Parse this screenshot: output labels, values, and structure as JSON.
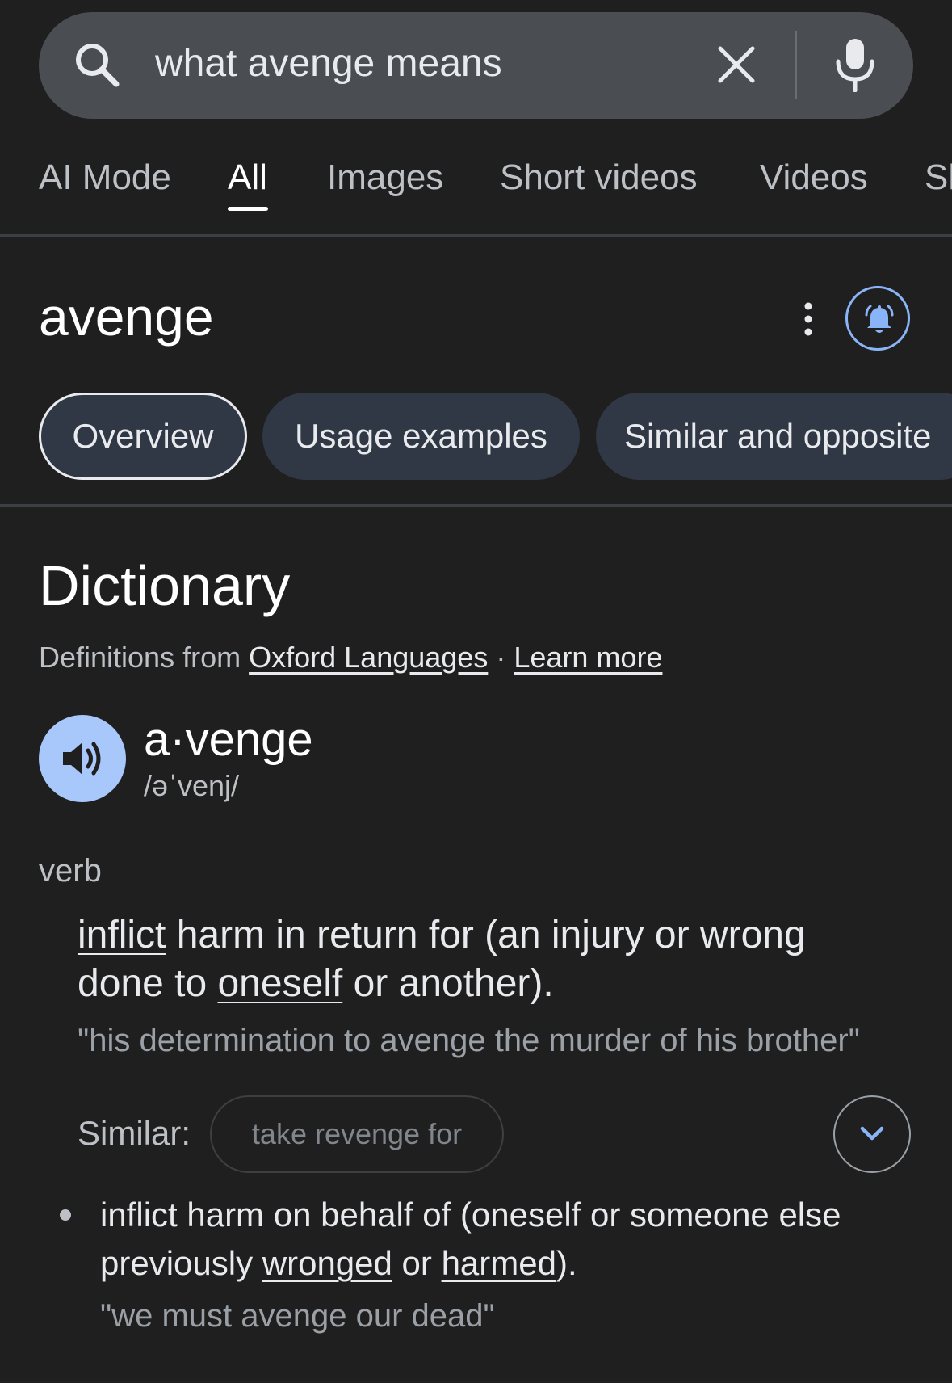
{
  "search": {
    "query": "what avenge means",
    "icons": {
      "search": "search-icon",
      "clear": "close-icon",
      "mic": "mic-icon"
    }
  },
  "tabs": [
    {
      "label": "AI Mode",
      "active": false
    },
    {
      "label": "All",
      "active": true
    },
    {
      "label": "Images",
      "active": false
    },
    {
      "label": "Short videos",
      "active": false
    },
    {
      "label": "Videos",
      "active": false
    },
    {
      "label": "Sh",
      "active": false
    }
  ],
  "header": {
    "word": "avenge",
    "icons": {
      "more": "more-vert-icon",
      "alert": "bell-icon"
    }
  },
  "chips": [
    {
      "label": "Overview",
      "active": true
    },
    {
      "label": "Usage examples",
      "active": false
    },
    {
      "label": "Similar and opposite",
      "active": false
    }
  ],
  "dictionary": {
    "title": "Dictionary",
    "source_prefix": "Definitions from",
    "source_link": "Oxford Languages",
    "separator": "·",
    "learn_more": "Learn more",
    "headword": "a·venge",
    "phonetic": "/əˈvenj/",
    "part_of_speech": "verb",
    "definitions": [
      {
        "parts": [
          {
            "text": "inflict",
            "link": true
          },
          {
            "text": " harm in return for (an injury or wrong done to ",
            "link": false
          },
          {
            "text": "oneself",
            "link": true
          },
          {
            "text": " or another).",
            "link": false
          }
        ],
        "example": "\"his determination to avenge the murder of his brother\"",
        "similar_label": "Similar:",
        "similar_chip": "take revenge for"
      },
      {
        "parts": [
          {
            "text": "inflict harm on behalf of (oneself or someone else previously ",
            "link": false
          },
          {
            "text": "wronged",
            "link": true
          },
          {
            "text": " or ",
            "link": false
          },
          {
            "text": "harmed",
            "link": true
          },
          {
            "text": ").",
            "link": false
          }
        ],
        "example": "\"we must avenge our dead\""
      }
    ]
  },
  "colors": {
    "background": "#1f1f1f",
    "search_bar": "#4a4d52",
    "chip_bg": "#303845",
    "accent_blue": "#8ab4f8",
    "speaker_bg": "#a8c7fa"
  }
}
